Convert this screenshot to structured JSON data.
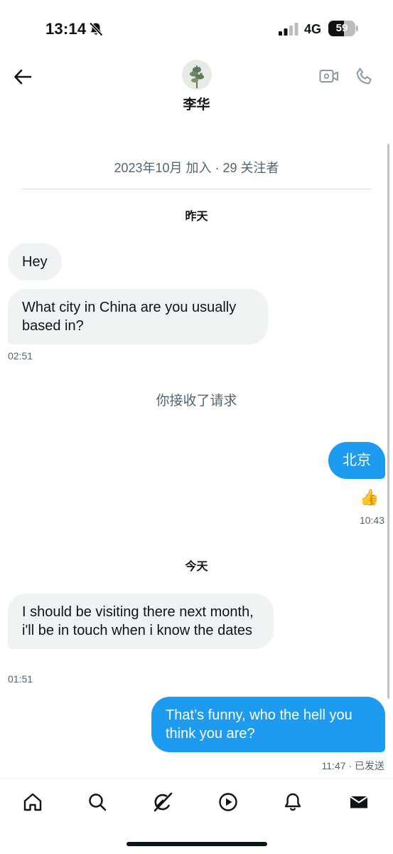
{
  "status_bar": {
    "time": "13:14",
    "network": "4G",
    "battery": "59",
    "battery_level": 0.59
  },
  "header": {
    "contact_name": "李华",
    "icons": [
      "back-arrow-icon",
      "video-camera-icon",
      "phone-icon"
    ]
  },
  "conversation": {
    "profile_meta": "2023年10月 加入 · 29 关注者",
    "day_yesterday": "昨天",
    "day_today": "今天",
    "system_note": "你接收了请求",
    "messages": [
      {
        "direction": "in",
        "text": "Hey"
      },
      {
        "direction": "in",
        "text": "What city in China are you usually based in?",
        "time": "02:51"
      },
      {
        "direction": "out",
        "text": "北京",
        "reaction": "👍",
        "time": "10:43"
      },
      {
        "direction": "in",
        "text": "I should be visiting there next month, i'll be in touch when i know the dates",
        "time": "01:51"
      },
      {
        "direction": "out",
        "text": "That’s funny, who the hell you think you are?",
        "time": "11:47",
        "status": " · 已发送"
      }
    ]
  },
  "bottom_nav": {
    "items": [
      "home-icon",
      "search-icon",
      "grok-icon",
      "video-play-icon",
      "notifications-bell-icon",
      "messages-envelope-icon"
    ],
    "active": "messages-envelope-icon"
  }
}
